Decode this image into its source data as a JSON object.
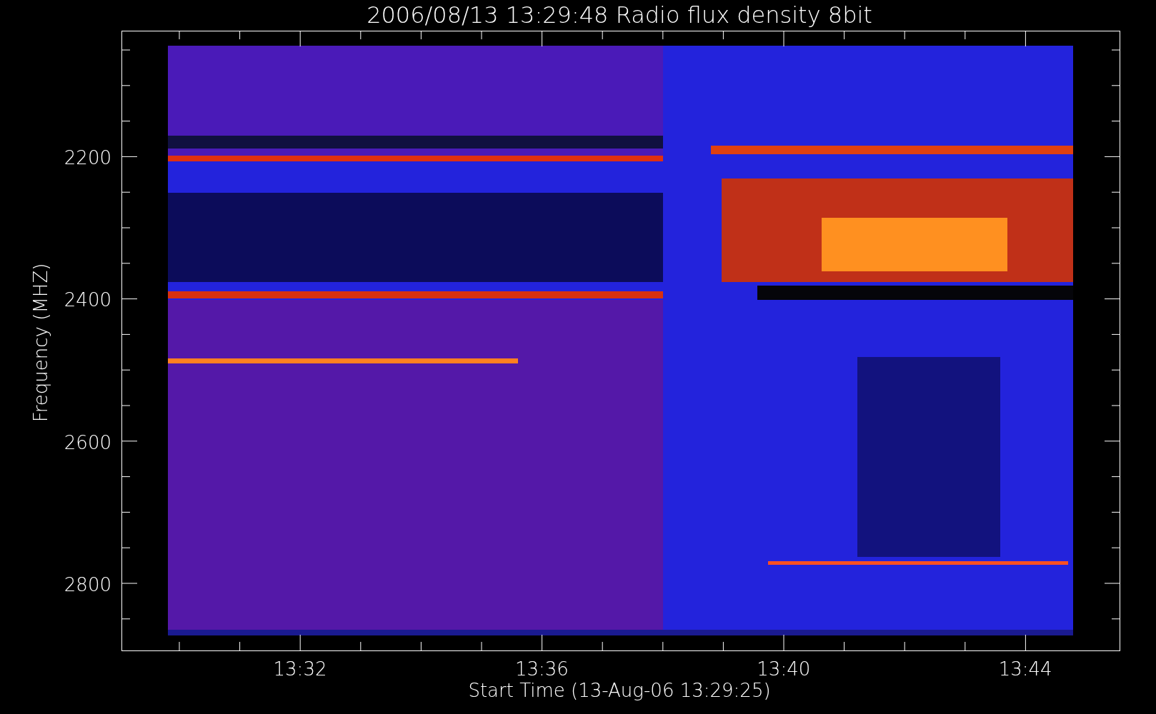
{
  "title": "2006/08/13 13:29:48 Radio flux density 8bit",
  "y_axis": {
    "label": "Frequency (MHZ)",
    "ticks": [
      "2200",
      "2400",
      "2600",
      "2800"
    ]
  },
  "x_axis": {
    "label": "Start Time (13-Aug-06 13:29:25)",
    "ticks": [
      "13:32",
      "13:36",
      "13:40",
      "13:44"
    ]
  }
}
